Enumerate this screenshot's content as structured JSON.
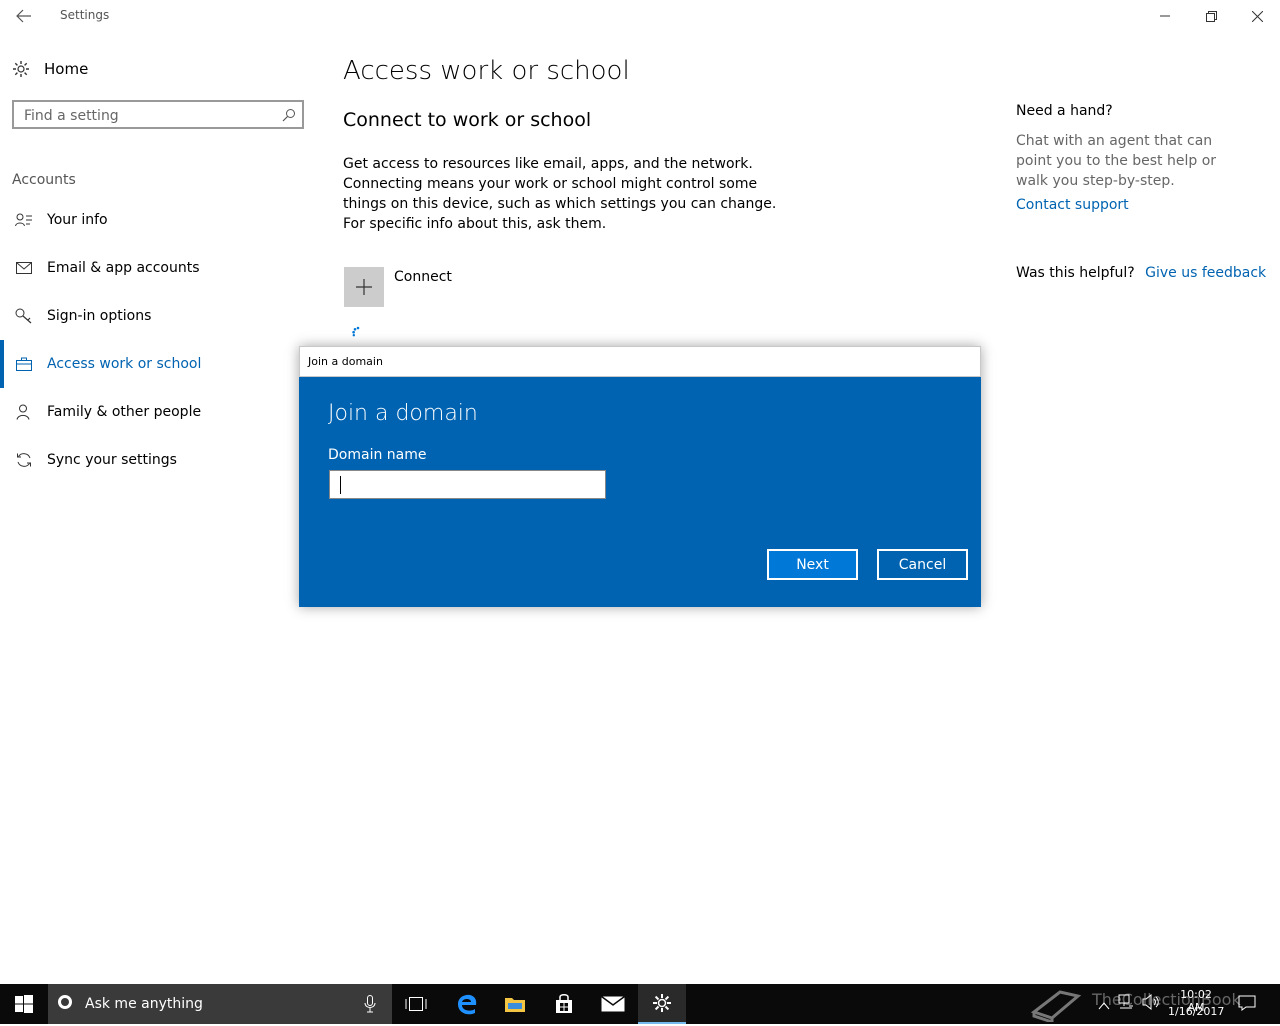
{
  "window": {
    "title": "Settings"
  },
  "sidebar": {
    "home_label": "Home",
    "search_placeholder": "Find a setting",
    "section_label": "Accounts",
    "items": [
      {
        "label": "Your info",
        "icon": "contact-icon"
      },
      {
        "label": "Email & app accounts",
        "icon": "mail-icon"
      },
      {
        "label": "Sign-in options",
        "icon": "key-icon"
      },
      {
        "label": "Access work or school",
        "icon": "briefcase-icon",
        "active": true
      },
      {
        "label": "Family & other people",
        "icon": "person-add-icon"
      },
      {
        "label": "Sync your settings",
        "icon": "sync-icon"
      }
    ]
  },
  "main": {
    "title": "Access work or school",
    "subtitle": "Connect to work or school",
    "description": "Get access to resources like email, apps, and the network. Connecting means your work or school might control some things on this device, such as which settings you can change. For specific info about this, ask them.",
    "connect_label": "Connect"
  },
  "help": {
    "heading": "Need a hand?",
    "text": "Chat with an agent that can point you to the best help or walk you step-by-step.",
    "contact_link": "Contact support",
    "helpful_question": "Was this helpful?",
    "feedback_link": "Give us feedback"
  },
  "dialog": {
    "window_title": "Join a domain",
    "heading": "Join a domain",
    "field_label": "Domain name",
    "field_value": "",
    "next_label": "Next",
    "cancel_label": "Cancel"
  },
  "taskbar": {
    "search_text": "Ask me anything",
    "watermark": "TheCollectionBook",
    "time": "10:02 AM",
    "date": "1/16/2017"
  },
  "colors": {
    "accent": "#0063b1",
    "dialog_bg": "#0063b1",
    "taskbar_bg": "#0a0a0a"
  }
}
